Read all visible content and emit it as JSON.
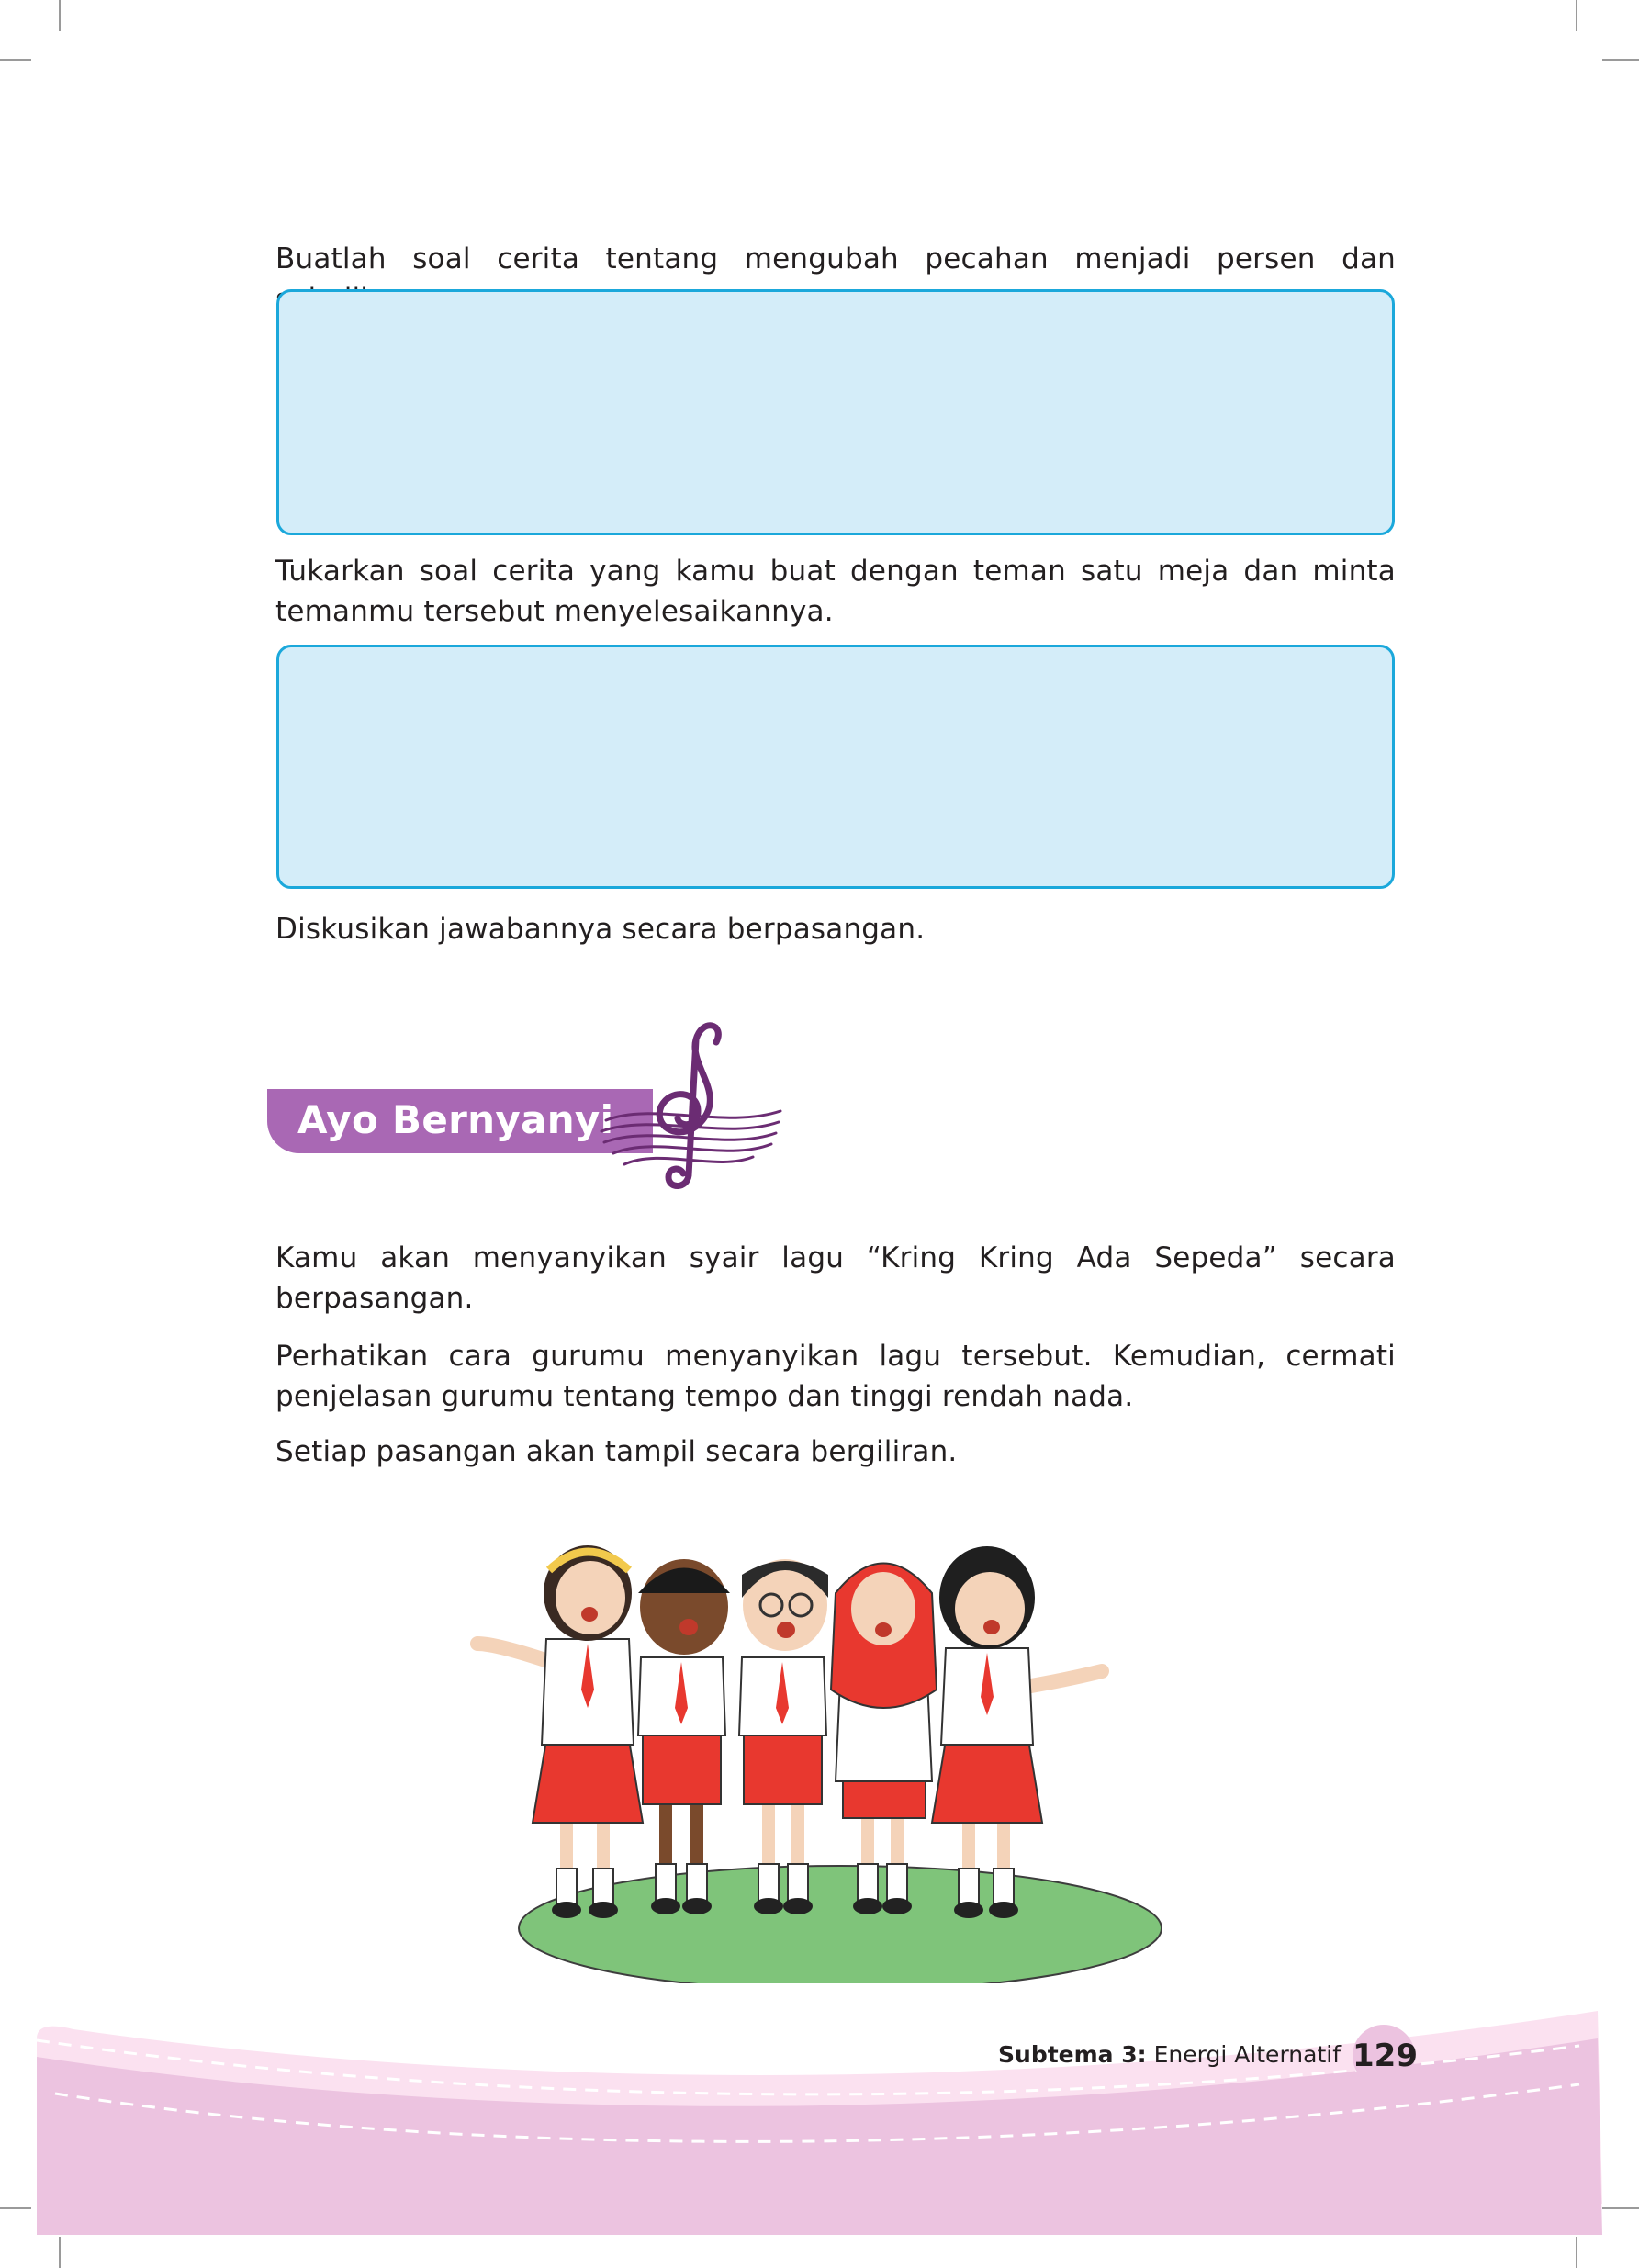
{
  "instructions": {
    "make_story": "Buatlah soal cerita tentang mengubah pecahan menjadi persen dan sebaliknya.",
    "exchange": "Tukarkan soal cerita yang kamu buat dengan teman satu meja dan minta temanmu tersebut menyelesaikannya.",
    "discuss": "Diskusikan jawabannya secara berpasangan."
  },
  "section": {
    "title": "Ayo Bernyanyi",
    "icon": "treble-clef-icon",
    "color": "#a968b4"
  },
  "singing": {
    "para1": "Kamu akan menyanyikan syair lagu “Kring Kring Ada Sepeda” secara berpasangan.",
    "para2": "Perhatikan cara gurumu menyanyikan lagu tersebut. Kemudian, cermati penjelasan gurumu tentang tempo dan tinggi rendah nada.",
    "para3": "Setiap pasangan akan tampil secara bergiliran."
  },
  "illustration": {
    "subject": "five students in red-white school uniforms singing on green grass"
  },
  "footer": {
    "subtheme_label": "Subtema 3:",
    "subtheme_name": " Energi Alternatif",
    "page_number": "129"
  },
  "colors": {
    "answer_box_fill": "#d4edf9",
    "answer_box_border": "#1ba8db",
    "footer_pink": "#ecc3e0",
    "uniform_red": "#e8382f",
    "grass_green": "#7fc47a"
  }
}
